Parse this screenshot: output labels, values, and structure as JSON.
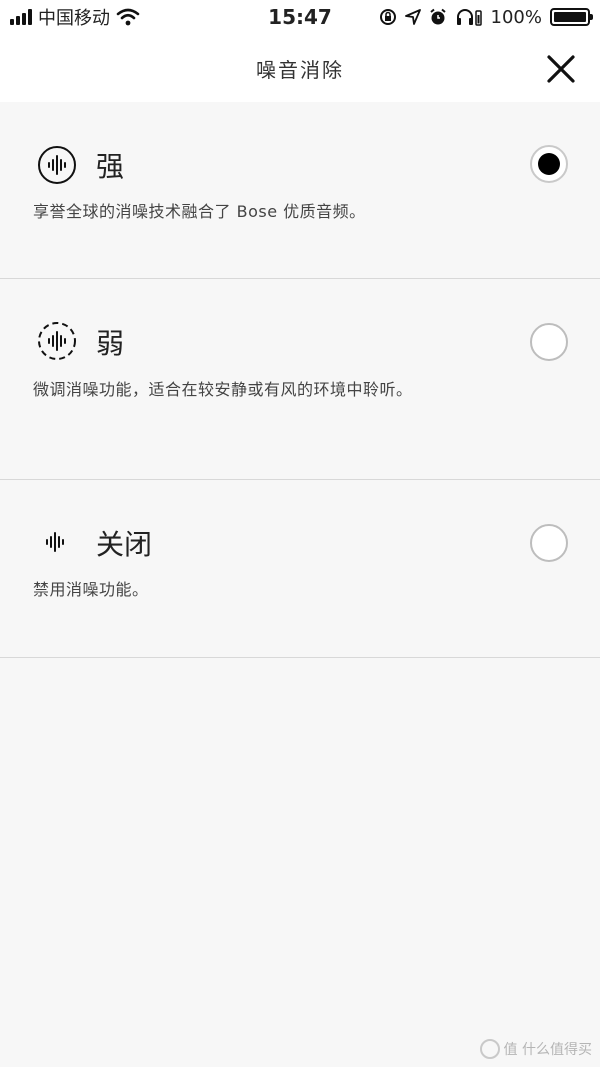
{
  "status_bar": {
    "carrier": "中国移动",
    "time": "15:47",
    "battery": "100%",
    "battery_level": 1.0,
    "icons": [
      "signal-icon",
      "wifi-icon",
      "rotation-lock-icon",
      "location-icon",
      "alarm-icon",
      "headphones-icon",
      "battery-icon"
    ]
  },
  "header": {
    "title": "噪音消除",
    "close_icon": "close-icon"
  },
  "options": [
    {
      "label": "强",
      "description": "享誉全球的消噪技术融合了 Bose 优质音频。",
      "selected": true,
      "icon": "noise-cancel-high-icon"
    },
    {
      "label": "弱",
      "description": "微调消噪功能，适合在较安静或有风的环境中聆听。",
      "selected": false,
      "icon": "noise-cancel-low-icon"
    },
    {
      "label": "关闭",
      "description": "禁用消噪功能。",
      "selected": false,
      "icon": "noise-cancel-off-icon"
    }
  ],
  "watermark": {
    "text": "值 什么值得买"
  },
  "colors": {
    "background": "#f7f7f7",
    "selected_radio": "#000000",
    "divider": "#d8d8d8"
  }
}
